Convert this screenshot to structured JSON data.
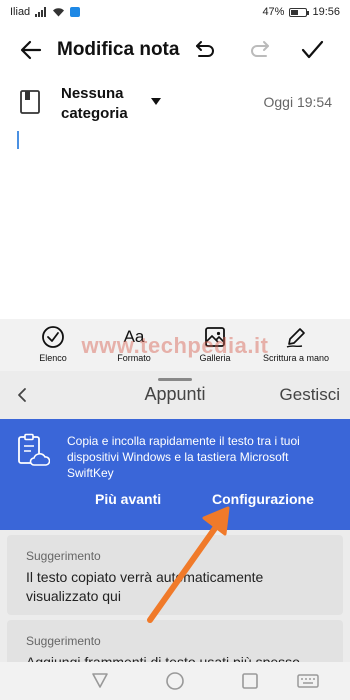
{
  "status_bar": {
    "carrier": "Iliad",
    "battery": "47%",
    "battery_level": 0.47,
    "time": "19:56"
  },
  "app_bar": {
    "title": "Modifica nota",
    "icons": [
      "back-arrow-icon",
      "undo-icon",
      "redo-icon",
      "check-icon"
    ]
  },
  "note": {
    "category": "Nessuna categoria",
    "time": "Oggi 19:54",
    "body": ""
  },
  "format_toolbar": {
    "items": [
      {
        "label": "Elenco",
        "icon": "checklist-icon"
      },
      {
        "label": "Formato",
        "icon": "text-format-icon",
        "glyph": "Aa"
      },
      {
        "label": "Galleria",
        "icon": "image-icon"
      },
      {
        "label": "Scrittura a mano",
        "icon": "pen-icon"
      }
    ]
  },
  "watermark": "www.techpedia.it",
  "clipboard_panel": {
    "title": "Appunti",
    "manage": "Gestisci",
    "promo": {
      "text": "Copia e incolla rapidamente il testo tra i tuoi dispositivi Windows e la tastiera Microsoft SwiftKey",
      "later": "Più avanti",
      "config": "Configurazione",
      "bg_color": "#3a66d8"
    },
    "suggestions": [
      {
        "title": "Suggerimento",
        "body": "Il testo copiato verrà automaticamente visualizzato qui"
      },
      {
        "title": "Suggerimento",
        "body": "Aggiungi frammenti di testo usati più spesso"
      }
    ]
  },
  "annotation_arrow_color": "#f07a2a",
  "nav_bar": {
    "buttons": [
      "nav-back-icon",
      "nav-home-icon",
      "nav-recents-icon",
      "keyboard-icon"
    ]
  }
}
